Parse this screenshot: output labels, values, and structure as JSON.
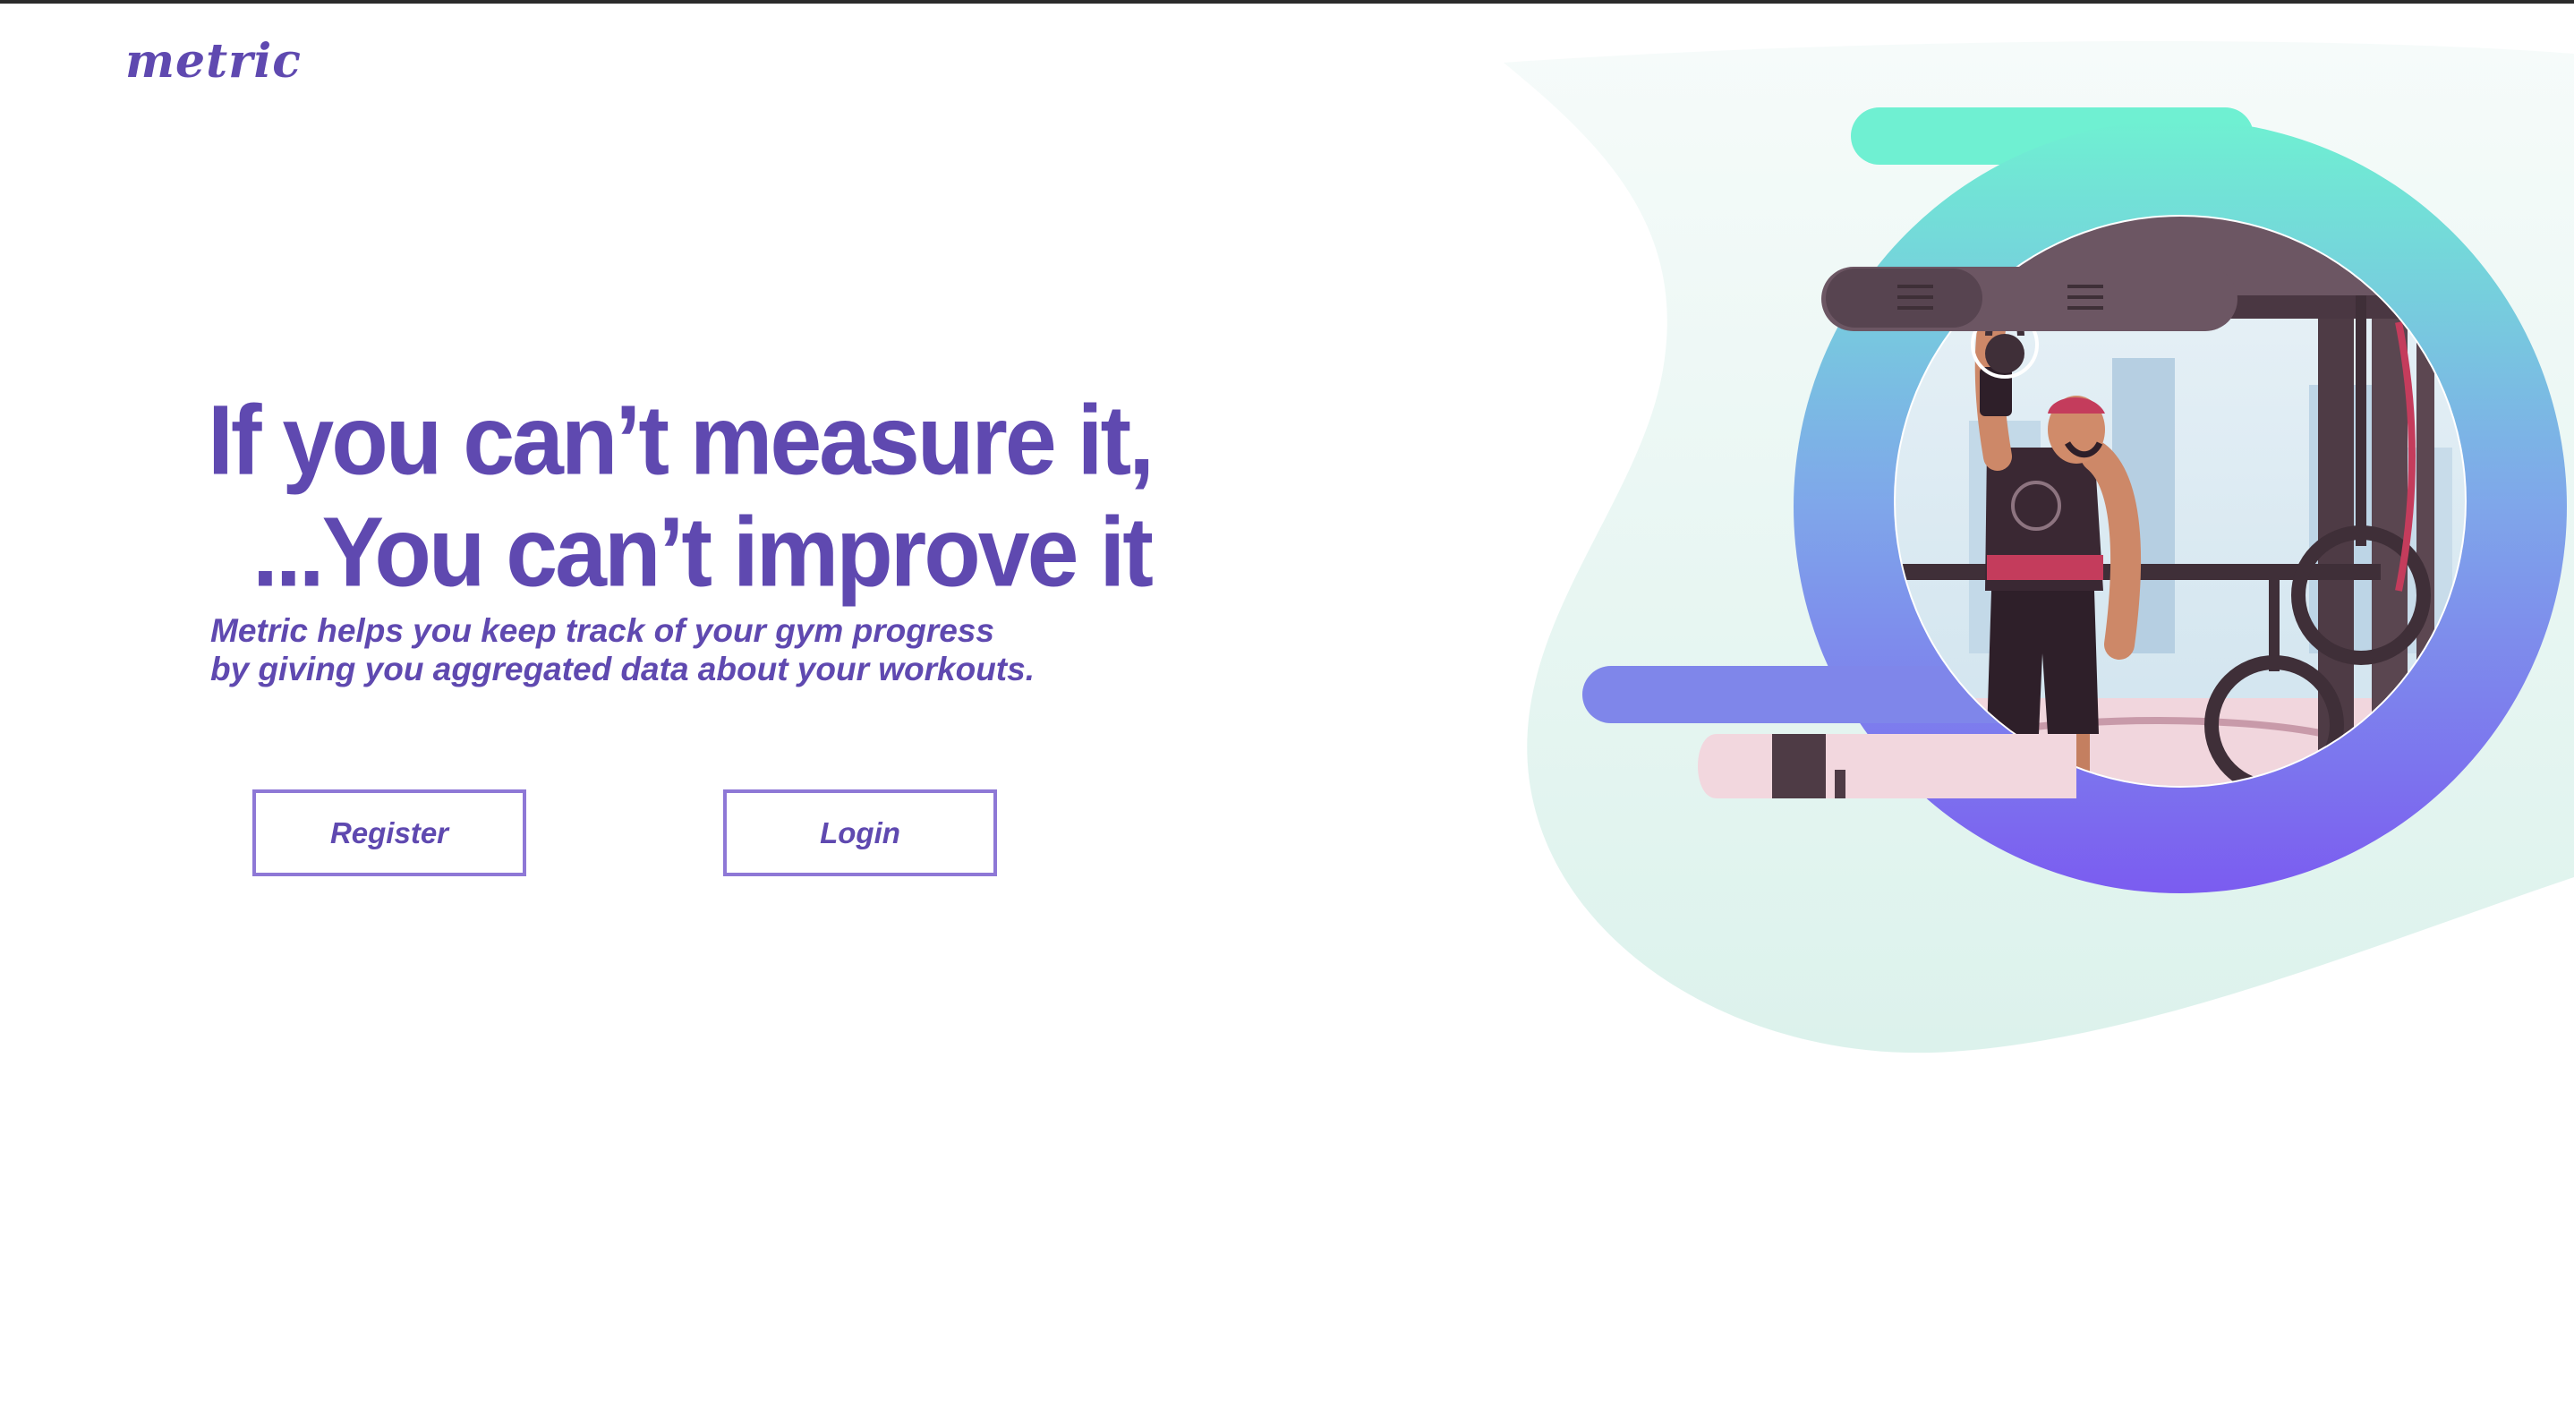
{
  "brand": {
    "logo_text": "metric"
  },
  "hero": {
    "headline_line1": "If you can’t measure it,",
    "headline_line2": "...You can’t improve it",
    "subtitle_line1": "Metric helps you keep track of your gym progress",
    "subtitle_line2": "by giving you aggregated data about your workouts."
  },
  "actions": {
    "register_label": "Register",
    "login_label": "Login"
  },
  "colors": {
    "brand_purple": "#5f49b0",
    "button_border": "#8e78d6",
    "gradient_top": "#6ff0d2",
    "gradient_bottom": "#7b5cf0",
    "blob_mint": "#e2f4ef"
  },
  "illustration": {
    "icon": "gym-athlete-kettlebell-illustration"
  }
}
